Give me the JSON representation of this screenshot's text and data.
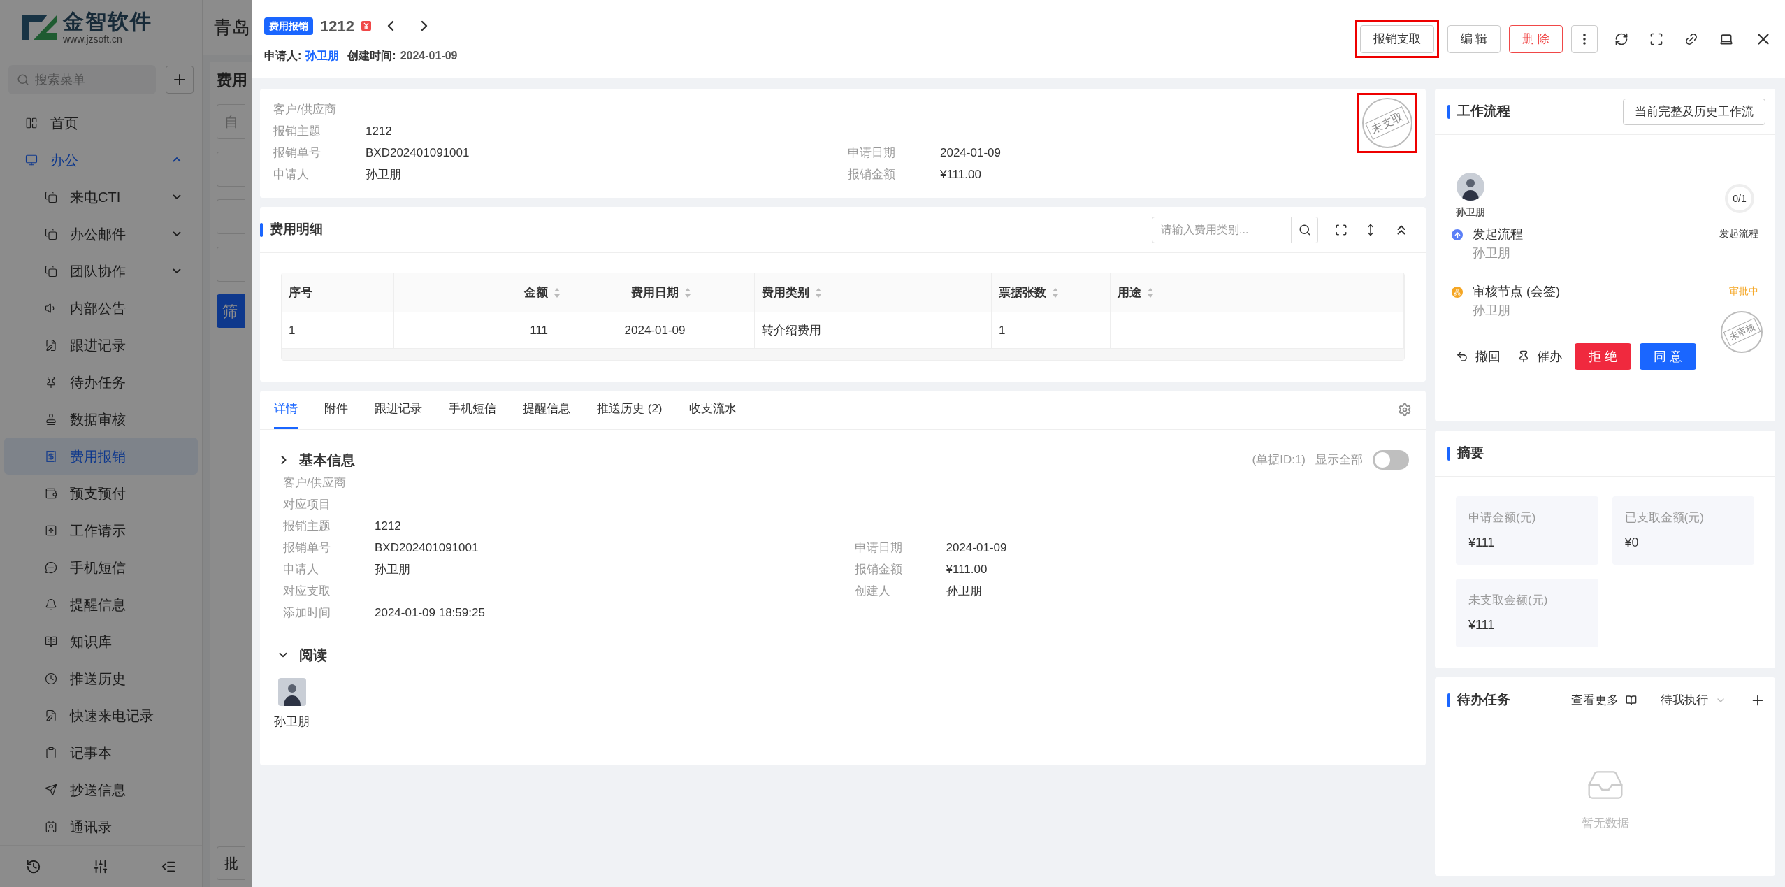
{
  "sidebar": {
    "logo": {
      "name": "金智软件",
      "url": "www.jzsoft.cn"
    },
    "search": {
      "placeholder": "搜索菜单"
    },
    "items": [
      {
        "label": "首页",
        "selected": false
      },
      {
        "label": "办公",
        "selected": false,
        "expanded": true,
        "children": [
          {
            "label": "来电CTI",
            "selected": false,
            "expanded": false
          },
          {
            "label": "办公邮件",
            "selected": false,
            "expanded": false
          },
          {
            "label": "团队协作",
            "selected": false,
            "expanded": false
          },
          {
            "label": "内部公告",
            "selected": false
          },
          {
            "label": "跟进记录",
            "selected": false
          },
          {
            "label": "待办任务",
            "selected": false
          },
          {
            "label": "数据审核",
            "selected": false
          },
          {
            "label": "费用报销",
            "selected": true
          },
          {
            "label": "预支预付",
            "selected": false
          },
          {
            "label": "工作请示",
            "selected": false
          },
          {
            "label": "手机短信",
            "selected": false
          },
          {
            "label": "提醒信息",
            "selected": false
          },
          {
            "label": "知识库",
            "selected": false
          },
          {
            "label": "推送历史",
            "selected": false
          },
          {
            "label": "快速来电记录",
            "selected": false
          },
          {
            "label": "记事本",
            "selected": false
          },
          {
            "label": "抄送信息",
            "selected": false
          },
          {
            "label": "通讯录",
            "selected": false
          }
        ]
      }
    ]
  },
  "background_page": {
    "company": "青岛",
    "page_title": "费用",
    "filter": "自",
    "filter_button": "筛",
    "batch_button": "批"
  },
  "drawer": {
    "header": {
      "tag": "费用报销",
      "number": "1212",
      "applicant_label": "申请人:",
      "applicant": "孙卫朋",
      "created_label": "创建时间:",
      "created": "2024-01-09",
      "actions": [
        {
          "label": "报销支取",
          "kind": "default",
          "highlighted": true
        },
        {
          "label": "编 辑",
          "kind": "default",
          "highlighted": false
        },
        {
          "label": "删 除",
          "kind": "danger",
          "highlighted": false
        }
      ]
    },
    "info": {
      "stamp": "未支取",
      "stamp_highlighted": true,
      "rows": [
        [
          {
            "label": "客户/供应商"
          }
        ],
        [
          {
            "label": "报销主题",
            "value": "1212"
          }
        ],
        [
          {
            "label": "报销单号",
            "value": "BXD202401091001"
          },
          {
            "label": "申请日期",
            "value": "2024-01-09"
          }
        ],
        [
          {
            "label": "申请人",
            "value": "孙卫朋"
          },
          {
            "label": "报销金额",
            "value": "¥111.00"
          }
        ]
      ]
    },
    "expense_detail": {
      "title": "费用明细",
      "search": {
        "placeholder": "请输入费用类别..."
      },
      "columns": [
        {
          "label": "序号",
          "sortable": false
        },
        {
          "label": "金额",
          "sortable": true
        },
        {
          "label": "费用日期",
          "sortable": true
        },
        {
          "label": "费用类别",
          "sortable": true
        },
        {
          "label": "票据张数",
          "sortable": true
        },
        {
          "label": "用途",
          "sortable": true
        }
      ],
      "rows": [
        [
          "1",
          "111",
          "2024-01-09",
          "转介绍费用",
          "1",
          ""
        ]
      ]
    },
    "tabs": [
      {
        "label": "详情",
        "selected": true
      },
      {
        "label": "附件",
        "selected": false
      },
      {
        "label": "跟进记录",
        "selected": false
      },
      {
        "label": "手机短信",
        "selected": false
      },
      {
        "label": "提醒信息",
        "selected": false
      },
      {
        "label": "推送历史 (2)",
        "selected": false
      },
      {
        "label": "收支流水",
        "selected": false
      }
    ],
    "basic_info": {
      "title": "基本信息",
      "doc_id": "(单据ID:1)",
      "show_all_label": "显示全部",
      "show_all_on": false,
      "rows": [
        [
          {
            "label": "客户/供应商"
          }
        ],
        [
          {
            "label": "对应项目"
          }
        ],
        [
          {
            "label": "报销主题",
            "value": "1212"
          }
        ],
        [
          {
            "label": "报销单号",
            "value": "BXD202401091001"
          },
          {
            "label": "申请日期",
            "value": "2024-01-09"
          }
        ],
        [
          {
            "label": "申请人",
            "value": "孙卫朋"
          },
          {
            "label": "报销金额",
            "value": "¥111.00"
          }
        ],
        [
          {
            "label": "对应支取"
          },
          {
            "label": "创建人",
            "value": "孙卫朋"
          }
        ],
        [
          {
            "label": "添加时间",
            "value": "2024-01-09 18:59:25"
          }
        ]
      ]
    },
    "read": {
      "title": "阅读",
      "readers": [
        {
          "name": "孙卫朋"
        }
      ]
    }
  },
  "workflow": {
    "title": "工作流程",
    "history_button": "当前完整及历史工作流",
    "initiator": "孙卫朋",
    "progress": "0/1",
    "steps": [
      {
        "kind": "start",
        "title": "发起流程",
        "person": "孙卫朋",
        "status": "发起流程"
      },
      {
        "kind": "review",
        "title": "审核节点 (会签)",
        "person": "孙卫朋",
        "status": "审批中"
      }
    ],
    "stamp": "未审核",
    "actions": [
      {
        "kind": "revoke",
        "label": "撤回"
      },
      {
        "kind": "urge",
        "label": "催办"
      },
      {
        "kind": "reject",
        "label": "拒 绝"
      },
      {
        "kind": "approve",
        "label": "同 意"
      }
    ]
  },
  "summary": {
    "title": "摘要",
    "items": [
      {
        "label": "申请金额(元)",
        "value": "¥111"
      },
      {
        "label": "已支取金额(元)",
        "value": "¥0"
      },
      {
        "label": "未支取金额(元)",
        "value": "¥111"
      }
    ]
  },
  "todo": {
    "title": "待办任务",
    "more": "查看更多",
    "filter": "待我执行",
    "empty": "暂无数据"
  }
}
